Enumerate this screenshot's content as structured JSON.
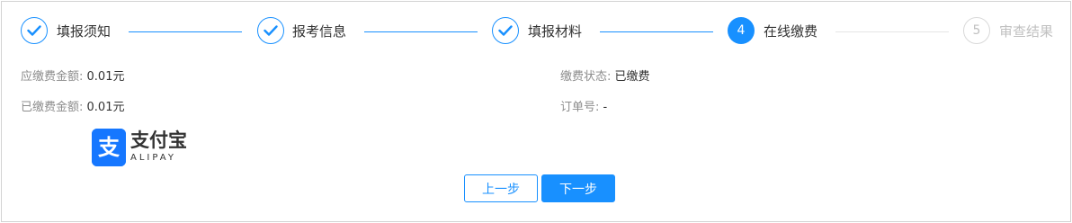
{
  "steps": [
    {
      "title": "填报须知",
      "status": "done"
    },
    {
      "title": "报考信息",
      "status": "done"
    },
    {
      "title": "填报材料",
      "status": "done"
    },
    {
      "title": "在线缴费",
      "status": "active",
      "number": "4"
    },
    {
      "title": "审查结果",
      "status": "todo",
      "number": "5"
    }
  ],
  "payment": {
    "amount_due_label": "应缴费金额:",
    "amount_due": "0.01元",
    "amount_paid_label": "已缴费金额:",
    "amount_paid": "0.01元",
    "status_label": "缴费状态:",
    "status": "已缴费",
    "order_label": "订单号:",
    "order": "-"
  },
  "alipay": {
    "glyph": "支",
    "name": "支付宝",
    "sub": "ALIPAY"
  },
  "buttons": {
    "prev": "上一步",
    "next": "下一步"
  },
  "colors": {
    "accent": "#1890ff",
    "alipay": "#1677ff",
    "todo": "#c0c0c0"
  }
}
